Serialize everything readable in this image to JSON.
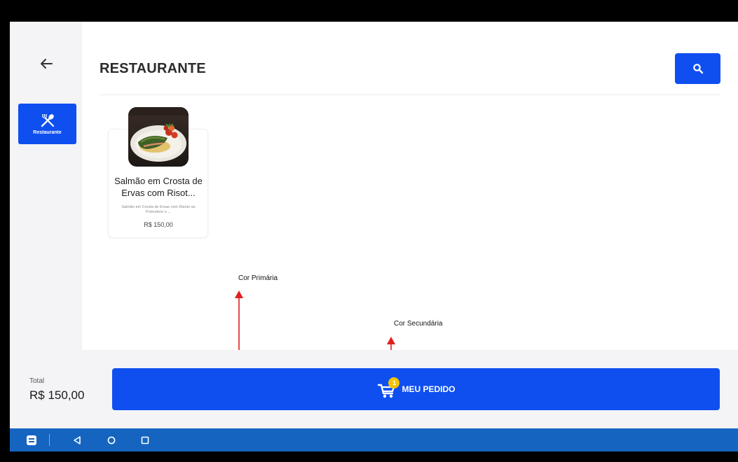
{
  "header": {
    "title": "RESTAURANTE"
  },
  "sidebar": {
    "items": [
      {
        "label": "Restaurante",
        "icon": "utensils-icon",
        "active": true
      }
    ]
  },
  "product": {
    "name": "Salmão em Crosta de Ervas com Risot...",
    "description": "Salmão em Crosta de Ervas com Risoto ao Pomodoro e ...",
    "price": "R$ 150,00"
  },
  "annotations": {
    "primary": "Cor Primária",
    "secondary": "Cor Secundária"
  },
  "footer": {
    "total_label": "Total",
    "total_value": "R$ 150,00",
    "order_label": "MEU PEDIDO",
    "cart_count": "1"
  },
  "colors": {
    "primary": "#0f4ff0",
    "secondary": "#f5c400",
    "navbar": "#1565c0",
    "annotation_arrow": "#e0201c"
  }
}
